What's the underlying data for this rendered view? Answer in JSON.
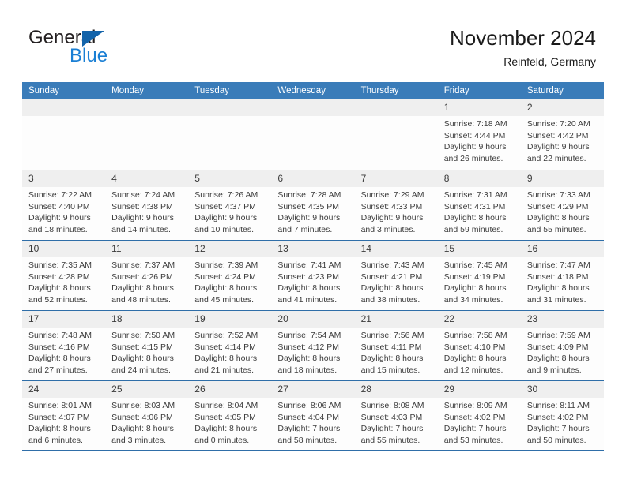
{
  "brand": {
    "name_part1": "General",
    "name_part2": "Blue",
    "triangle_color": "#1464aa",
    "blue_color": "#1a7fd4"
  },
  "header": {
    "title": "November 2024",
    "subtitle": "Reinfeld, Germany"
  },
  "theme": {
    "header_blue": "#3a7cb9",
    "grid_line": "#2f6ea8",
    "day_head_gray": "#efefef"
  },
  "weekdays": [
    "Sunday",
    "Monday",
    "Tuesday",
    "Wednesday",
    "Thursday",
    "Friday",
    "Saturday"
  ],
  "weeks": [
    [
      {
        "day": "",
        "lines": []
      },
      {
        "day": "",
        "lines": []
      },
      {
        "day": "",
        "lines": []
      },
      {
        "day": "",
        "lines": []
      },
      {
        "day": "",
        "lines": []
      },
      {
        "day": "1",
        "lines": [
          "Sunrise: 7:18 AM",
          "Sunset: 4:44 PM",
          "Daylight: 9 hours",
          "and 26 minutes."
        ]
      },
      {
        "day": "2",
        "lines": [
          "Sunrise: 7:20 AM",
          "Sunset: 4:42 PM",
          "Daylight: 9 hours",
          "and 22 minutes."
        ]
      }
    ],
    [
      {
        "day": "3",
        "lines": [
          "Sunrise: 7:22 AM",
          "Sunset: 4:40 PM",
          "Daylight: 9 hours",
          "and 18 minutes."
        ]
      },
      {
        "day": "4",
        "lines": [
          "Sunrise: 7:24 AM",
          "Sunset: 4:38 PM",
          "Daylight: 9 hours",
          "and 14 minutes."
        ]
      },
      {
        "day": "5",
        "lines": [
          "Sunrise: 7:26 AM",
          "Sunset: 4:37 PM",
          "Daylight: 9 hours",
          "and 10 minutes."
        ]
      },
      {
        "day": "6",
        "lines": [
          "Sunrise: 7:28 AM",
          "Sunset: 4:35 PM",
          "Daylight: 9 hours",
          "and 7 minutes."
        ]
      },
      {
        "day": "7",
        "lines": [
          "Sunrise: 7:29 AM",
          "Sunset: 4:33 PM",
          "Daylight: 9 hours",
          "and 3 minutes."
        ]
      },
      {
        "day": "8",
        "lines": [
          "Sunrise: 7:31 AM",
          "Sunset: 4:31 PM",
          "Daylight: 8 hours",
          "and 59 minutes."
        ]
      },
      {
        "day": "9",
        "lines": [
          "Sunrise: 7:33 AM",
          "Sunset: 4:29 PM",
          "Daylight: 8 hours",
          "and 55 minutes."
        ]
      }
    ],
    [
      {
        "day": "10",
        "lines": [
          "Sunrise: 7:35 AM",
          "Sunset: 4:28 PM",
          "Daylight: 8 hours",
          "and 52 minutes."
        ]
      },
      {
        "day": "11",
        "lines": [
          "Sunrise: 7:37 AM",
          "Sunset: 4:26 PM",
          "Daylight: 8 hours",
          "and 48 minutes."
        ]
      },
      {
        "day": "12",
        "lines": [
          "Sunrise: 7:39 AM",
          "Sunset: 4:24 PM",
          "Daylight: 8 hours",
          "and 45 minutes."
        ]
      },
      {
        "day": "13",
        "lines": [
          "Sunrise: 7:41 AM",
          "Sunset: 4:23 PM",
          "Daylight: 8 hours",
          "and 41 minutes."
        ]
      },
      {
        "day": "14",
        "lines": [
          "Sunrise: 7:43 AM",
          "Sunset: 4:21 PM",
          "Daylight: 8 hours",
          "and 38 minutes."
        ]
      },
      {
        "day": "15",
        "lines": [
          "Sunrise: 7:45 AM",
          "Sunset: 4:19 PM",
          "Daylight: 8 hours",
          "and 34 minutes."
        ]
      },
      {
        "day": "16",
        "lines": [
          "Sunrise: 7:47 AM",
          "Sunset: 4:18 PM",
          "Daylight: 8 hours",
          "and 31 minutes."
        ]
      }
    ],
    [
      {
        "day": "17",
        "lines": [
          "Sunrise: 7:48 AM",
          "Sunset: 4:16 PM",
          "Daylight: 8 hours",
          "and 27 minutes."
        ]
      },
      {
        "day": "18",
        "lines": [
          "Sunrise: 7:50 AM",
          "Sunset: 4:15 PM",
          "Daylight: 8 hours",
          "and 24 minutes."
        ]
      },
      {
        "day": "19",
        "lines": [
          "Sunrise: 7:52 AM",
          "Sunset: 4:14 PM",
          "Daylight: 8 hours",
          "and 21 minutes."
        ]
      },
      {
        "day": "20",
        "lines": [
          "Sunrise: 7:54 AM",
          "Sunset: 4:12 PM",
          "Daylight: 8 hours",
          "and 18 minutes."
        ]
      },
      {
        "day": "21",
        "lines": [
          "Sunrise: 7:56 AM",
          "Sunset: 4:11 PM",
          "Daylight: 8 hours",
          "and 15 minutes."
        ]
      },
      {
        "day": "22",
        "lines": [
          "Sunrise: 7:58 AM",
          "Sunset: 4:10 PM",
          "Daylight: 8 hours",
          "and 12 minutes."
        ]
      },
      {
        "day": "23",
        "lines": [
          "Sunrise: 7:59 AM",
          "Sunset: 4:09 PM",
          "Daylight: 8 hours",
          "and 9 minutes."
        ]
      }
    ],
    [
      {
        "day": "24",
        "lines": [
          "Sunrise: 8:01 AM",
          "Sunset: 4:07 PM",
          "Daylight: 8 hours",
          "and 6 minutes."
        ]
      },
      {
        "day": "25",
        "lines": [
          "Sunrise: 8:03 AM",
          "Sunset: 4:06 PM",
          "Daylight: 8 hours",
          "and 3 minutes."
        ]
      },
      {
        "day": "26",
        "lines": [
          "Sunrise: 8:04 AM",
          "Sunset: 4:05 PM",
          "Daylight: 8 hours",
          "and 0 minutes."
        ]
      },
      {
        "day": "27",
        "lines": [
          "Sunrise: 8:06 AM",
          "Sunset: 4:04 PM",
          "Daylight: 7 hours",
          "and 58 minutes."
        ]
      },
      {
        "day": "28",
        "lines": [
          "Sunrise: 8:08 AM",
          "Sunset: 4:03 PM",
          "Daylight: 7 hours",
          "and 55 minutes."
        ]
      },
      {
        "day": "29",
        "lines": [
          "Sunrise: 8:09 AM",
          "Sunset: 4:02 PM",
          "Daylight: 7 hours",
          "and 53 minutes."
        ]
      },
      {
        "day": "30",
        "lines": [
          "Sunrise: 8:11 AM",
          "Sunset: 4:02 PM",
          "Daylight: 7 hours",
          "and 50 minutes."
        ]
      }
    ]
  ]
}
